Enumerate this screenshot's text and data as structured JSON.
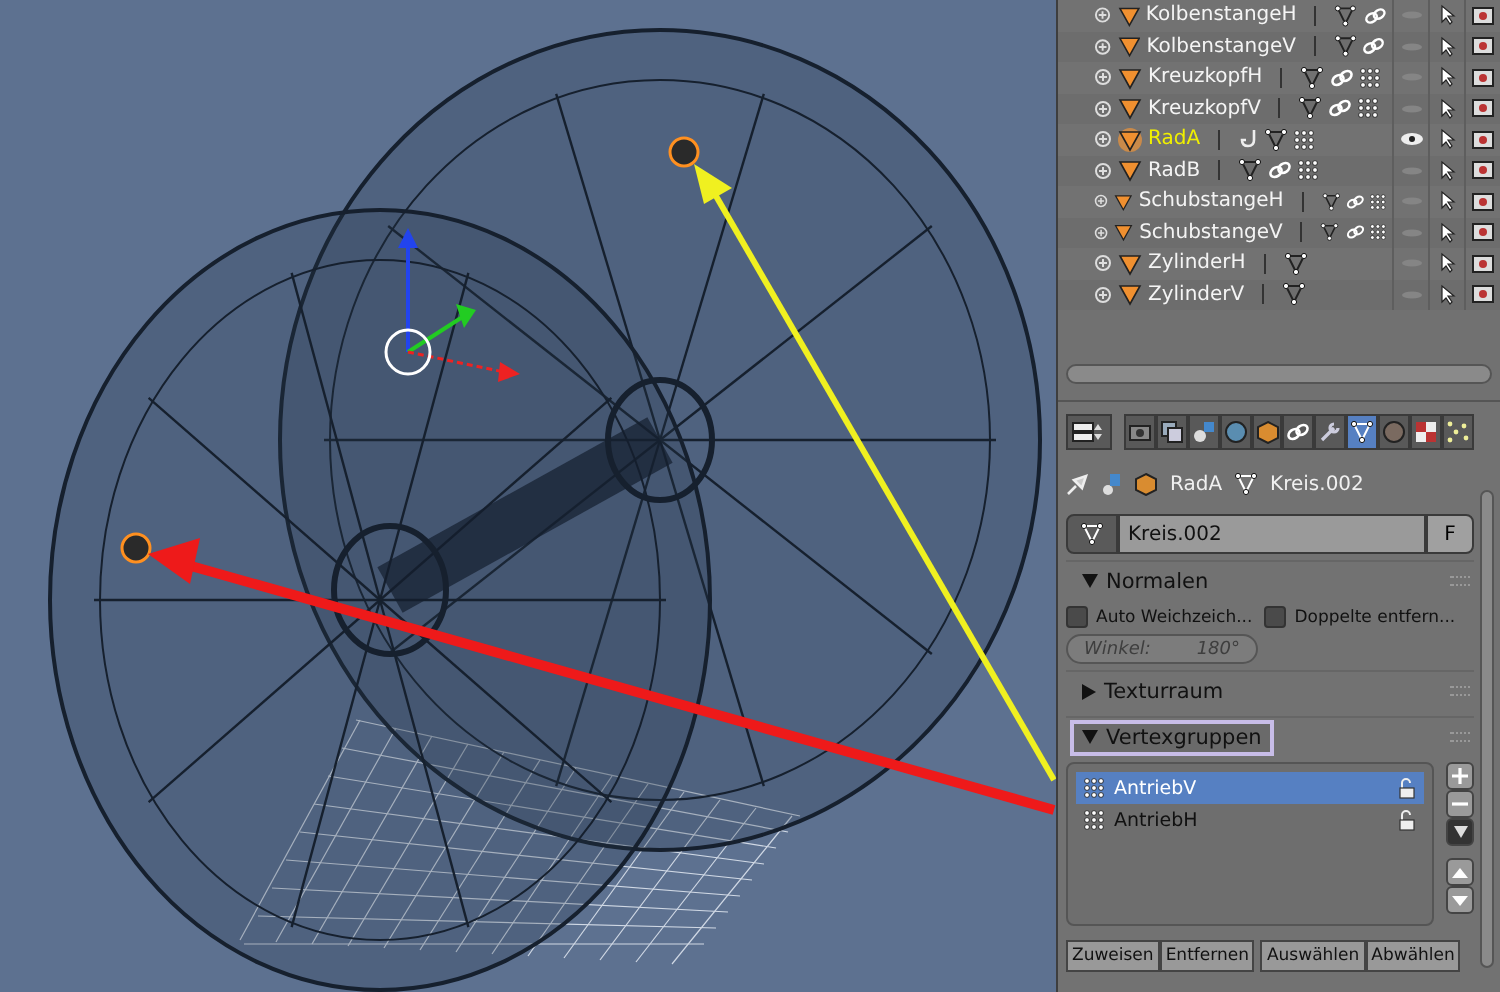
{
  "outliner": {
    "items": [
      {
        "name": "KolbenstangeH",
        "selected": false,
        "icons": [
          {
            "kind": "mesh"
          },
          {
            "kind": "link"
          }
        ]
      },
      {
        "name": "KolbenstangeV",
        "selected": false,
        "icons": [
          {
            "kind": "mesh"
          },
          {
            "kind": "link"
          }
        ]
      },
      {
        "name": "KreuzkopfH",
        "selected": false,
        "icons": [
          {
            "kind": "mesh"
          },
          {
            "kind": "link"
          },
          {
            "kind": "vertices"
          }
        ]
      },
      {
        "name": "KreuzkopfV",
        "selected": false,
        "icons": [
          {
            "kind": "mesh"
          },
          {
            "kind": "link"
          },
          {
            "kind": "vertices"
          }
        ]
      },
      {
        "name": "RadA",
        "selected": true,
        "icons": [
          {
            "kind": "hook"
          },
          {
            "kind": "mesh"
          },
          {
            "kind": "vertices"
          }
        ]
      },
      {
        "name": "RadB",
        "selected": false,
        "icons": [
          {
            "kind": "mesh"
          },
          {
            "kind": "link"
          },
          {
            "kind": "vertices"
          }
        ]
      },
      {
        "name": "SchubstangeH",
        "selected": false,
        "icons": [
          {
            "kind": "mesh"
          },
          {
            "kind": "link"
          },
          {
            "kind": "vertices"
          }
        ]
      },
      {
        "name": "SchubstangeV",
        "selected": false,
        "icons": [
          {
            "kind": "mesh"
          },
          {
            "kind": "link"
          },
          {
            "kind": "vertices"
          }
        ]
      },
      {
        "name": "ZylinderH",
        "selected": false,
        "icons": [
          {
            "kind": "mesh"
          }
        ]
      },
      {
        "name": "ZylinderV",
        "selected": false,
        "icons": [
          {
            "kind": "mesh"
          }
        ]
      }
    ]
  },
  "properties": {
    "tabs": [
      {
        "kind": "render",
        "selected": false
      },
      {
        "kind": "layers",
        "selected": false
      },
      {
        "kind": "scene",
        "selected": false
      },
      {
        "kind": "world",
        "selected": false
      },
      {
        "kind": "object",
        "selected": false
      },
      {
        "kind": "constraints",
        "selected": false
      },
      {
        "kind": "modifiers",
        "selected": false
      },
      {
        "kind": "data",
        "selected": true
      },
      {
        "kind": "material",
        "selected": false
      },
      {
        "kind": "texture",
        "selected": false
      },
      {
        "kind": "particles",
        "selected": false
      }
    ],
    "breadcrumb": [
      "RadA",
      "Kreis.002"
    ],
    "mesh_field": {
      "value": "Kreis.002",
      "fake_user": "F"
    },
    "normals": {
      "title": "Normalen",
      "expanded": true,
      "checkboxes": [
        {
          "label": "Auto Weichzeich...",
          "checked": false
        },
        {
          "label": "Doppelte entfern...",
          "checked": false
        }
      ],
      "angle": {
        "label": "Winkel:",
        "value": "180°",
        "disabled": true
      }
    },
    "texture_space": {
      "title": "Texturraum",
      "expanded": false
    },
    "vertex_groups": {
      "title": "Vertexgruppen",
      "expanded": true,
      "highlighted": true,
      "items": [
        {
          "name": "AntriebV",
          "selected": true
        },
        {
          "name": "AntriebH",
          "selected": false
        }
      ],
      "buttons": [
        "Zuweisen",
        "Entfernen",
        "Auswählen",
        "Abwählen"
      ]
    }
  }
}
